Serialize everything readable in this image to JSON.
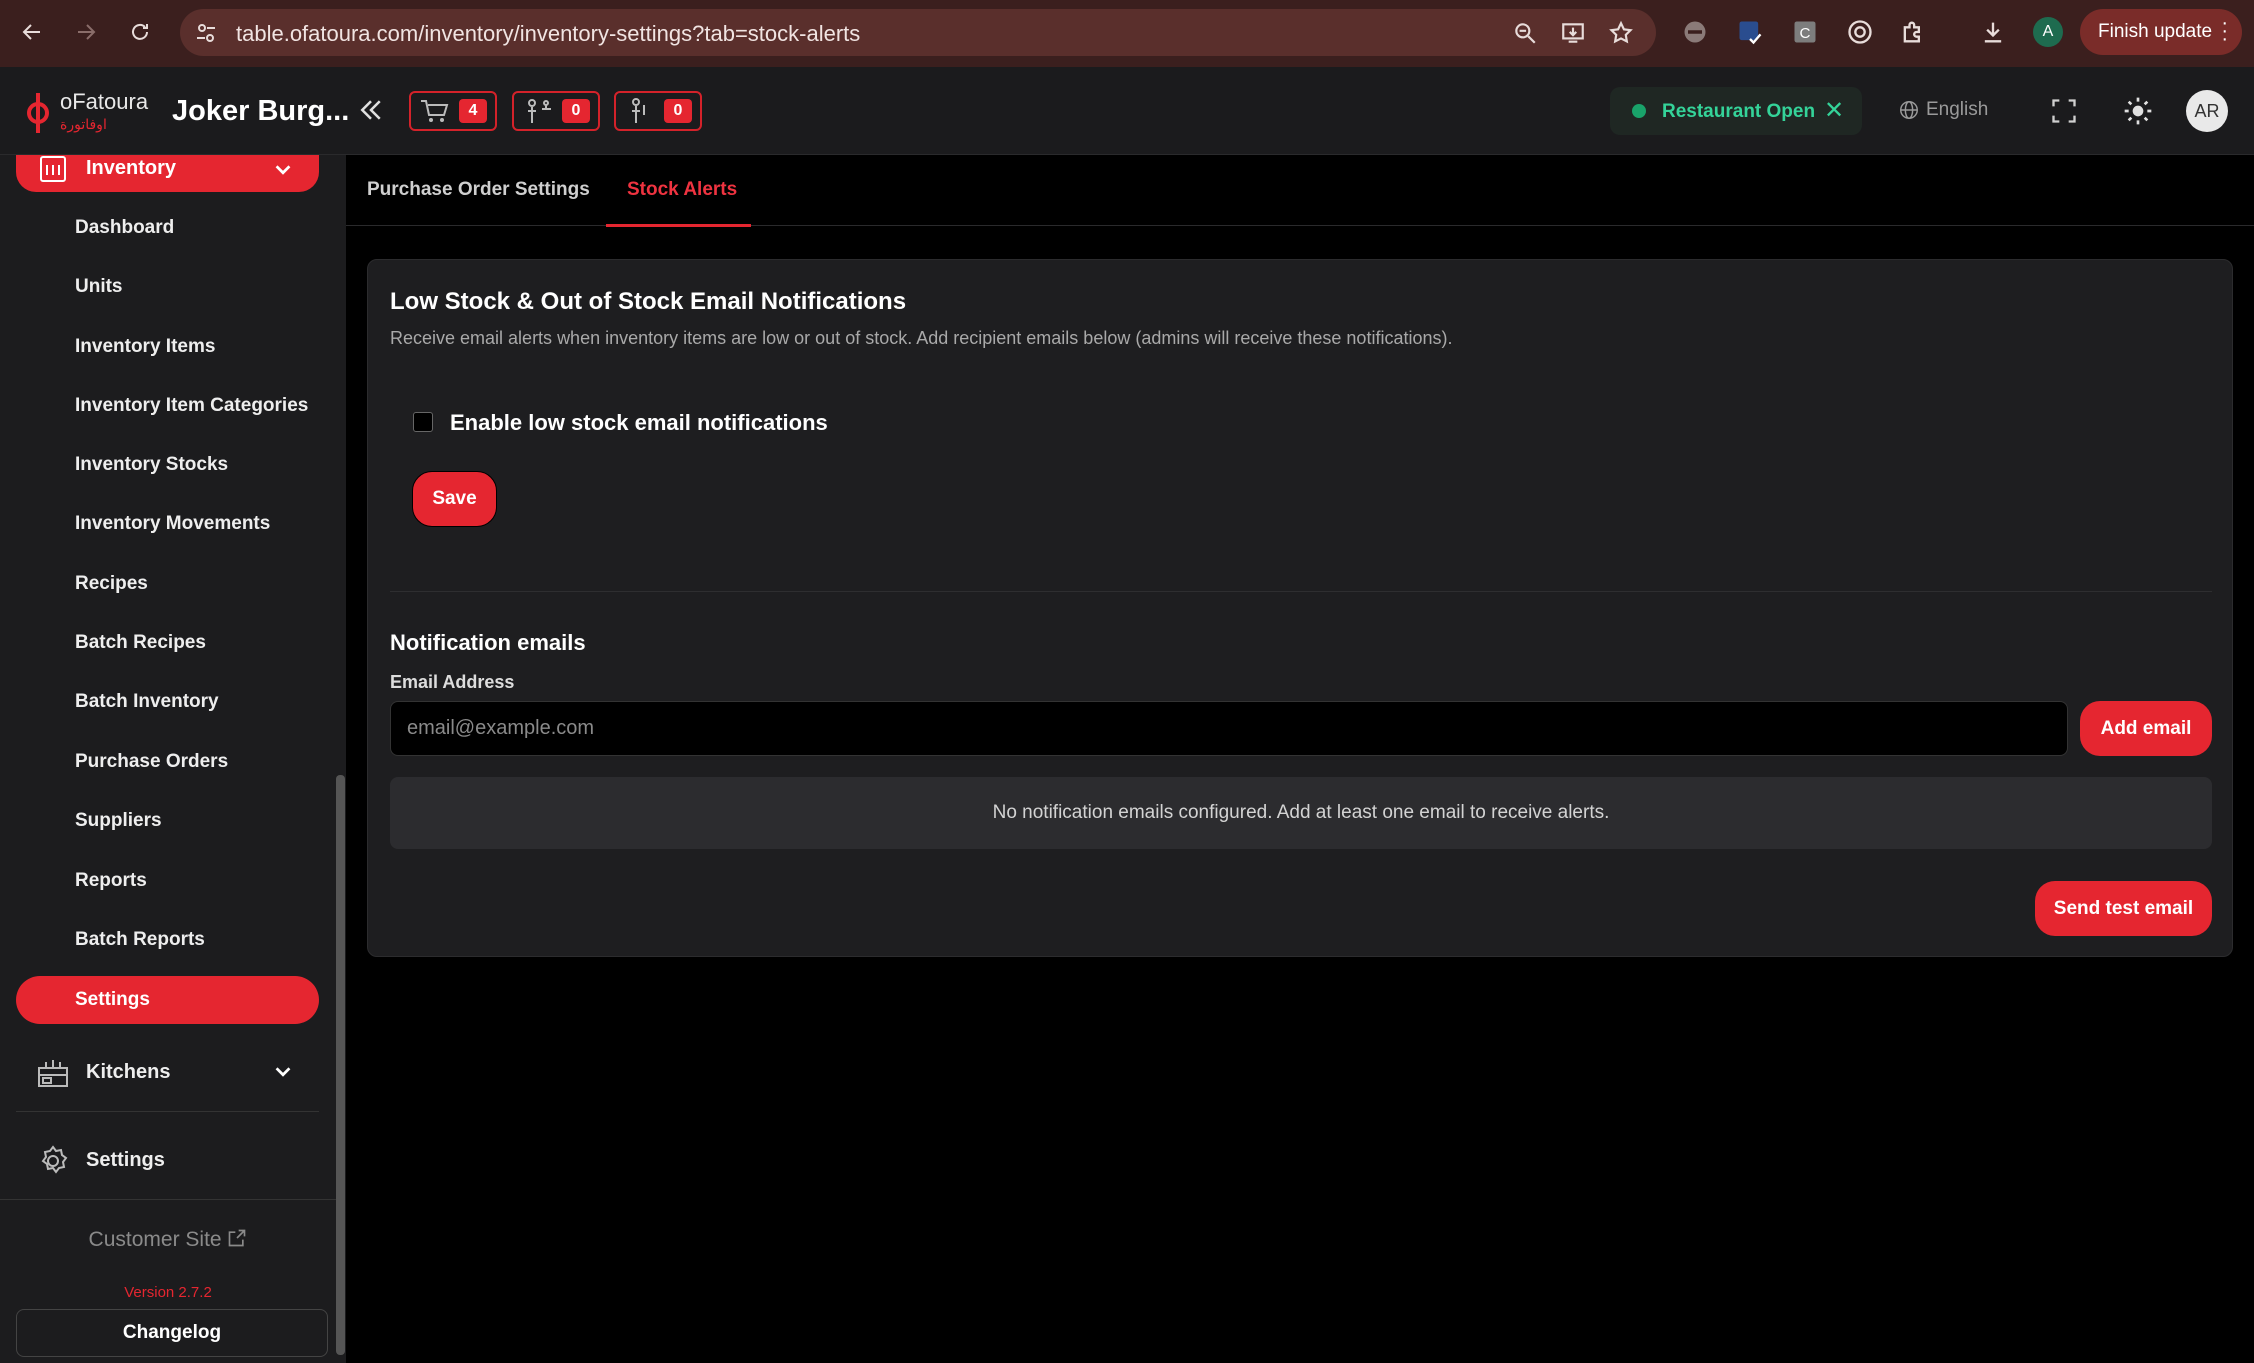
{
  "browser": {
    "url": "table.ofatoura.com/inventory/inventory-settings?tab=stock-alerts",
    "profile_initial": "A",
    "finish_update_label": "Finish update",
    "extension_c_label": "C"
  },
  "header": {
    "logo_text": "oFatoura",
    "logo_arabic": "اوفاتورة",
    "restaurant_name": "Joker Burg...",
    "counters": [
      {
        "icon": "cart-icon",
        "count": "4"
      },
      {
        "icon": "waiter-icon",
        "count": "0"
      },
      {
        "icon": "person-icon",
        "count": "0"
      }
    ],
    "status_label": "Restaurant Open",
    "status_close": "✕",
    "language": "English",
    "avatar_initials": "AR",
    "colors": {
      "accent": "#e52630",
      "status": "#34d399"
    }
  },
  "sidebar": {
    "group_label": "Inventory",
    "items": [
      "Dashboard",
      "Units",
      "Inventory Items",
      "Inventory Item Categories",
      "Inventory Stocks",
      "Inventory Movements",
      "Recipes",
      "Batch Recipes",
      "Batch Inventory",
      "Purchase Orders",
      "Suppliers",
      "Reports",
      "Batch Reports"
    ],
    "active_item": "Settings",
    "kitchens_label": "Kitchens",
    "settings_label": "Settings",
    "customer_site": "Customer Site",
    "version": "Version 2.7.2",
    "changelog": "Changelog"
  },
  "tabs": {
    "purchase_order_settings": "Purchase Order Settings",
    "stock_alerts": "Stock Alerts",
    "active": "Stock Alerts"
  },
  "card": {
    "title": "Low Stock & Out of Stock Email Notifications",
    "description": "Receive email alerts when inventory items are low or out of stock. Add recipient emails below (admins will receive these notifications).",
    "enable_label": "Enable low stock email notifications",
    "enable_checked": false,
    "save_label": "Save",
    "notif_title": "Notification emails",
    "email_label": "Email Address",
    "email_placeholder": "email@example.com",
    "email_value": "",
    "add_email_label": "Add email",
    "empty_message": "No notification emails configured. Add at least one email to receive alerts.",
    "test_email_label": "Send test email"
  }
}
